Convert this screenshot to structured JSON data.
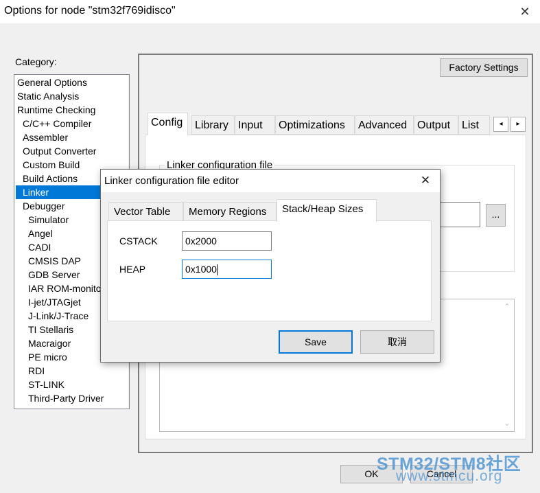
{
  "window": {
    "title": "Options for node \"stm32f769idisco\"",
    "close_glyph": "✕"
  },
  "category": {
    "label": "Category:",
    "items": [
      {
        "label": "General Options",
        "level": 0
      },
      {
        "label": "Static Analysis",
        "level": 0
      },
      {
        "label": "Runtime Checking",
        "level": 0
      },
      {
        "label": "C/C++ Compiler",
        "level": 1
      },
      {
        "label": "Assembler",
        "level": 1
      },
      {
        "label": "Output Converter",
        "level": 1
      },
      {
        "label": "Custom Build",
        "level": 1
      },
      {
        "label": "Build Actions",
        "level": 1
      },
      {
        "label": "Linker",
        "level": 1
      },
      {
        "label": "Debugger",
        "level": 1
      },
      {
        "label": "Simulator",
        "level": 2
      },
      {
        "label": "Angel",
        "level": 2
      },
      {
        "label": "CADI",
        "level": 2
      },
      {
        "label": "CMSIS DAP",
        "level": 2
      },
      {
        "label": "GDB Server",
        "level": 2
      },
      {
        "label": "IAR ROM-monitor",
        "level": 2
      },
      {
        "label": "I-jet/JTAGjet",
        "level": 2
      },
      {
        "label": "J-Link/J-Trace",
        "level": 2
      },
      {
        "label": "TI Stellaris",
        "level": 2
      },
      {
        "label": "Macraigor",
        "level": 2
      },
      {
        "label": "PE micro",
        "level": 2
      },
      {
        "label": "RDI",
        "level": 2
      },
      {
        "label": "ST-LINK",
        "level": 2
      },
      {
        "label": "Third-Party Driver",
        "level": 2
      }
    ],
    "selected": "Linker"
  },
  "panel": {
    "factory_settings": "Factory Settings",
    "tabs": [
      "Config",
      "Library",
      "Input",
      "Optimizations",
      "Advanced",
      "Output",
      "List"
    ],
    "active_tab": "Config",
    "tab_scroll_left": "◂",
    "tab_scroll_right": "▸",
    "group_label": "Linker configuration file",
    "browse_label": "..."
  },
  "footer": {
    "ok": "OK",
    "cancel": "Cancel"
  },
  "watermark": {
    "line1": "STM32/STM8社区",
    "line2": "www.stmcu.org"
  },
  "dialog": {
    "title": "Linker configuration file editor",
    "close_glyph": "✕",
    "tabs": [
      "Vector Table",
      "Memory Regions",
      "Stack/Heap Sizes"
    ],
    "active_tab": "Stack/Heap Sizes",
    "fields": {
      "cstack_label": "CSTACK",
      "cstack_value": "0x2000",
      "heap_label": "HEAP",
      "heap_value": "0x1000"
    },
    "save": "Save",
    "cancel": "取消"
  },
  "colors": {
    "selection": "#0078d7",
    "window_bg": "#f0f0f0",
    "button_bg": "#e1e1e1",
    "focus_border": "#0078d7"
  },
  "icons": {
    "scroll_up": "chevron-up-icon",
    "scroll_down": "chevron-down-icon",
    "close": "close-icon"
  }
}
